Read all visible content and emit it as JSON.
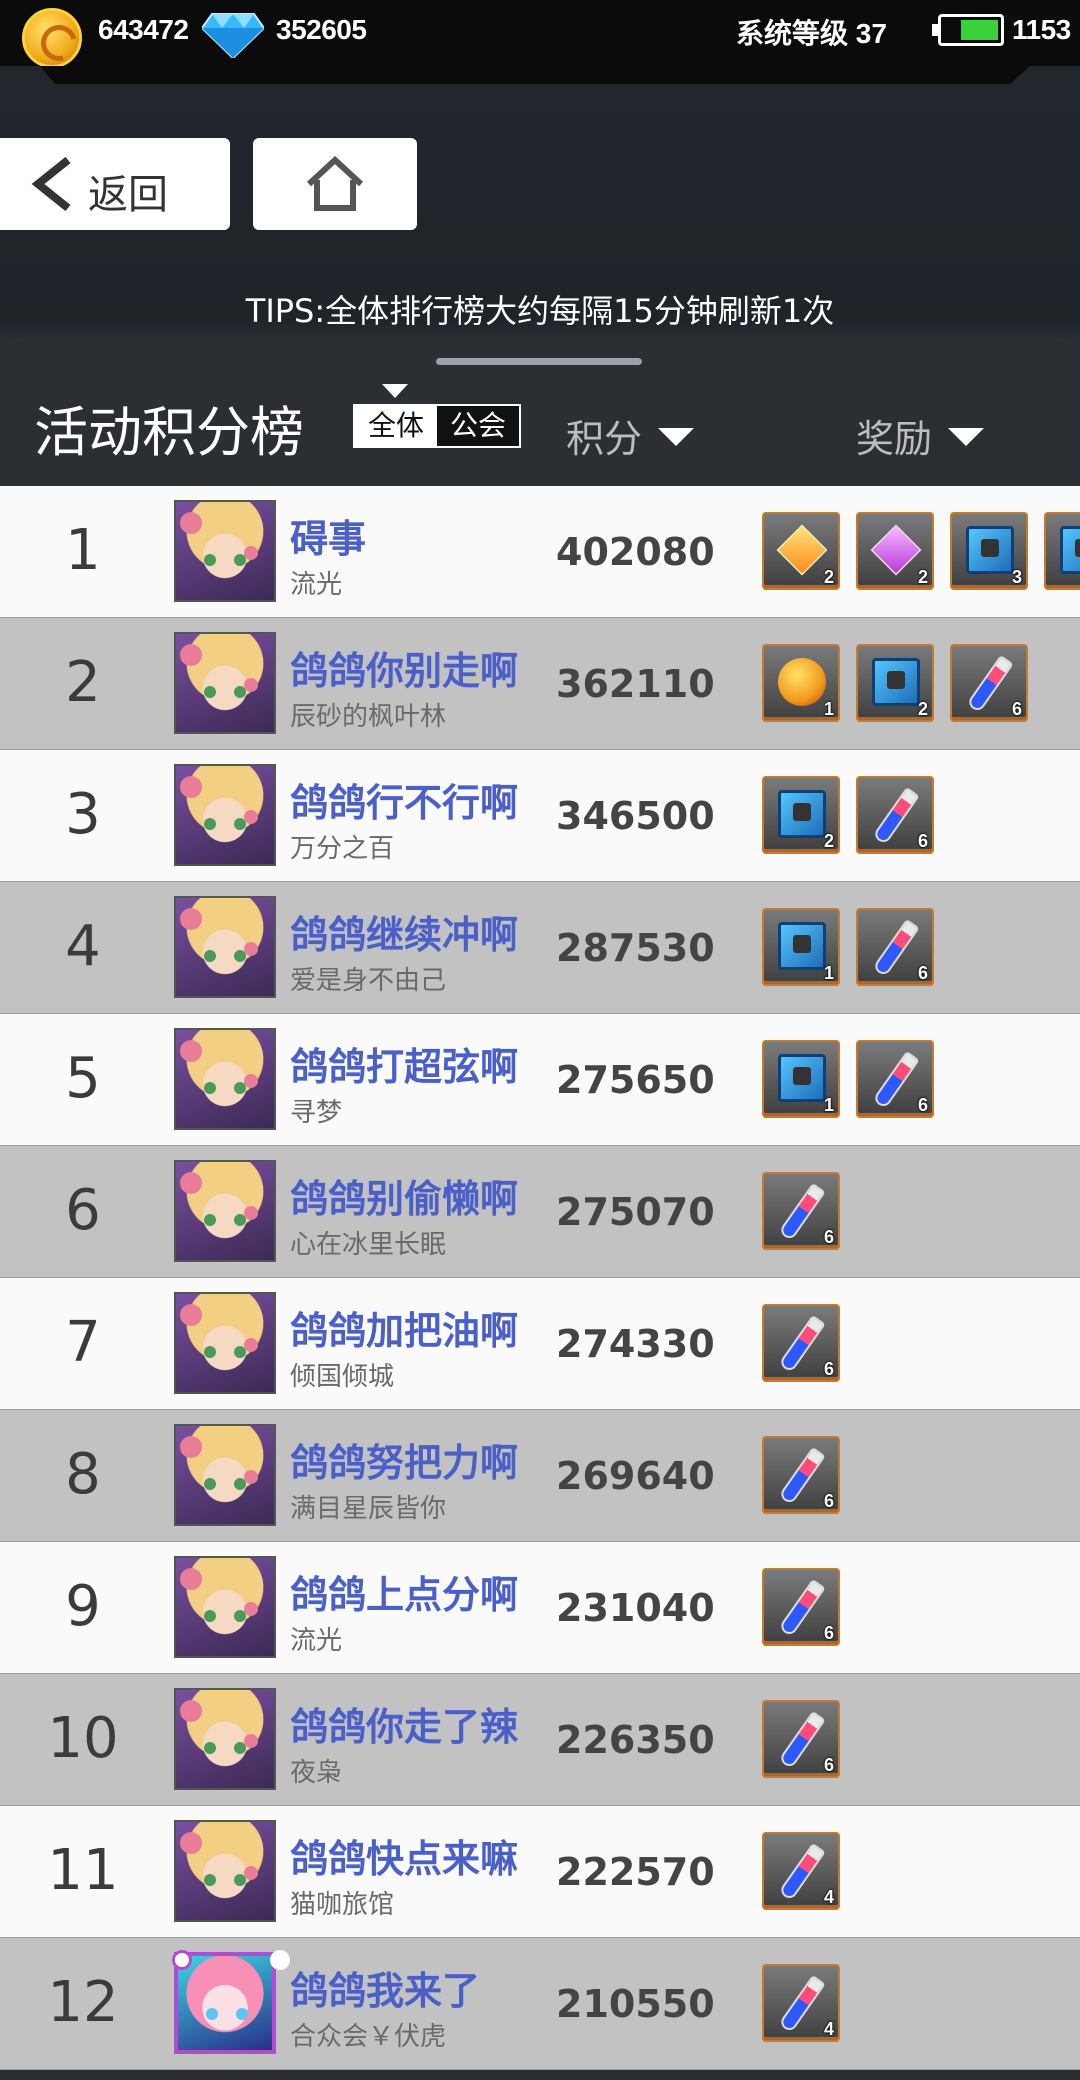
{
  "topbar": {
    "gold": "643472",
    "diamonds": "352605",
    "system_level": "系统等级 37",
    "energy": "1153",
    "icons": [
      "gold-coin-icon",
      "diamond-icon",
      "battery-icon"
    ]
  },
  "nav": {
    "back_label": "返回",
    "home_icon": "home-icon"
  },
  "tips": "TIPS:全体排行榜大约每隔15分钟刷新1次",
  "panel": {
    "title": "活动积分榜",
    "toggle": {
      "all": "全体",
      "guild": "公会",
      "selected": "全体"
    },
    "score_header": "积分",
    "reward_header": "奖励"
  },
  "colors": {
    "name": "#4a5fc8",
    "row_light": "#fafafa",
    "row_dark": "#c2c2c2",
    "accent": "#c87a2c"
  },
  "rows": [
    {
      "rank": "1",
      "name": "碍事",
      "guild": "流光",
      "score": "402080",
      "rewards": [
        {
          "icon": "fire-crystal-icon",
          "count": "2"
        },
        {
          "icon": "purple-crystal-icon",
          "count": "2"
        },
        {
          "icon": "chip-icon",
          "count": "3"
        },
        {
          "icon": "item-icon",
          "count": ""
        }
      ]
    },
    {
      "rank": "2",
      "name": "鸽鸽你别走啊",
      "guild": "辰砂的枫叶林",
      "score": "362110",
      "rewards": [
        {
          "icon": "gold-orb-icon",
          "count": "1"
        },
        {
          "icon": "chip-icon",
          "count": "2"
        },
        {
          "icon": "vial-icon",
          "count": "6"
        }
      ]
    },
    {
      "rank": "3",
      "name": "鸽鸽行不行啊",
      "guild": "万分之百",
      "score": "346500",
      "rewards": [
        {
          "icon": "chip-icon",
          "count": "2"
        },
        {
          "icon": "vial-icon",
          "count": "6"
        }
      ]
    },
    {
      "rank": "4",
      "name": "鸽鸽继续冲啊",
      "guild": "爱是身不由己",
      "score": "287530",
      "rewards": [
        {
          "icon": "chip-icon",
          "count": "1"
        },
        {
          "icon": "vial-icon",
          "count": "6"
        }
      ]
    },
    {
      "rank": "5",
      "name": "鸽鸽打超弦啊",
      "guild": "寻梦",
      "score": "275650",
      "rewards": [
        {
          "icon": "chip-icon",
          "count": "1"
        },
        {
          "icon": "vial-icon",
          "count": "6"
        }
      ]
    },
    {
      "rank": "6",
      "name": "鸽鸽别偷懒啊",
      "guild": "心在冰里长眠",
      "score": "275070",
      "rewards": [
        {
          "icon": "vial-icon",
          "count": "6"
        }
      ]
    },
    {
      "rank": "7",
      "name": "鸽鸽加把油啊",
      "guild": "倾国倾城",
      "score": "274330",
      "rewards": [
        {
          "icon": "vial-icon",
          "count": "6"
        }
      ]
    },
    {
      "rank": "8",
      "name": "鸽鸽努把力啊",
      "guild": "满目星辰皆你",
      "score": "269640",
      "rewards": [
        {
          "icon": "vial-icon",
          "count": "6"
        }
      ]
    },
    {
      "rank": "9",
      "name": "鸽鸽上点分啊",
      "guild": "流光",
      "score": "231040",
      "rewards": [
        {
          "icon": "vial-icon",
          "count": "6"
        }
      ]
    },
    {
      "rank": "10",
      "name": "鸽鸽你走了辣",
      "guild": "夜枭",
      "score": "226350",
      "rewards": [
        {
          "icon": "vial-icon",
          "count": "6"
        }
      ]
    },
    {
      "rank": "11",
      "name": "鸽鸽快点来嘛",
      "guild": "猫咖旅馆",
      "score": "222570",
      "rewards": [
        {
          "icon": "vial-icon",
          "count": "4"
        }
      ]
    },
    {
      "rank": "12",
      "name": "鸽鸽我来了",
      "guild": "合众会￥伏虎",
      "score": "210550",
      "rewards": [
        {
          "icon": "vial-icon",
          "count": "4"
        }
      ]
    }
  ]
}
